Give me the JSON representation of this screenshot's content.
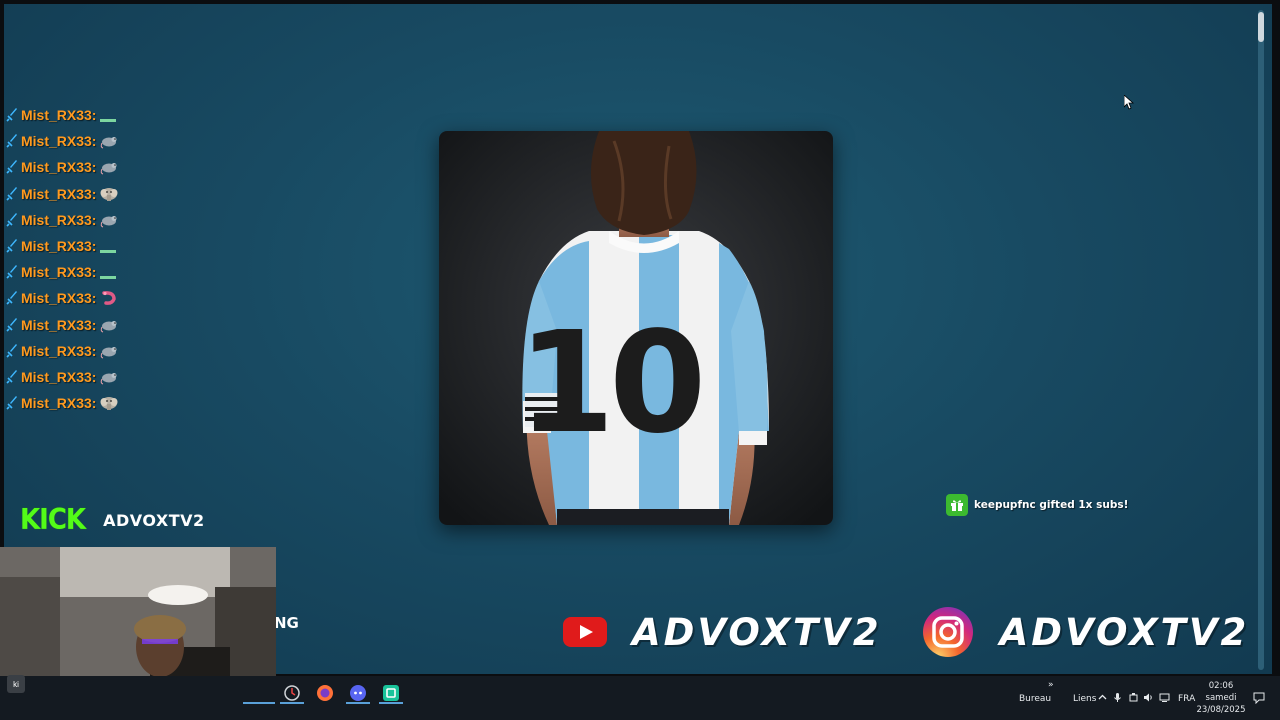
{
  "chat": {
    "username": "Mist_RX33:",
    "lines": [
      {
        "emote": "dash"
      },
      {
        "emote": "rat"
      },
      {
        "emote": "rat"
      },
      {
        "emote": "elephant"
      },
      {
        "emote": "rat"
      },
      {
        "emote": "dash"
      },
      {
        "emote": "dash"
      },
      {
        "emote": "shrimp"
      },
      {
        "emote": "rat"
      },
      {
        "emote": "rat"
      },
      {
        "emote": "rat"
      },
      {
        "emote": "elephant"
      }
    ]
  },
  "kick": {
    "logo": "KICK",
    "channel": "ADVOXTV2",
    "brand_color": "#53fc18"
  },
  "overlay_partial_text": "NG",
  "alert": {
    "text": "keepupfnc gifted 1x subs!",
    "icon": "gift-icon",
    "color": "#3cba30"
  },
  "socials": {
    "youtube": {
      "handle": "ADVOXTV2",
      "icon": "youtube-icon"
    },
    "instagram": {
      "handle": "ADVOXTV2",
      "icon": "instagram-icon"
    }
  },
  "webcam": {
    "tag": "ki"
  },
  "taskbar": {
    "bureau_label": "Bureau",
    "liens_label": "Liens",
    "language": "FRA",
    "time": "02:06",
    "day": "samedi",
    "date": "23/08/2025",
    "chevron": "»"
  }
}
